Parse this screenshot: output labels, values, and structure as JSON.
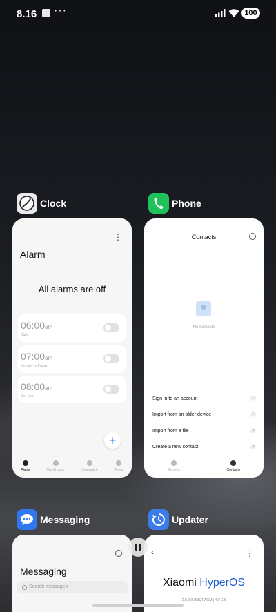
{
  "status_bar": {
    "time": "8.16",
    "more": "···",
    "battery": "100"
  },
  "apps": {
    "clock": {
      "name": "Clock",
      "screen_title": "Alarm",
      "empty_message": "All alarms are off",
      "alarms": [
        {
          "time": "06:00",
          "period": "am",
          "sub": "Daily"
        },
        {
          "time": "07:00",
          "period": "am",
          "sub": "Monday to Friday"
        },
        {
          "time": "08:00",
          "period": "am",
          "sub": "Get Sub"
        }
      ],
      "nav": [
        "Alarm",
        "World clock",
        "Stopwatch",
        "Timer"
      ]
    },
    "phone": {
      "name": "Phone",
      "screen_title": "Contacts",
      "empty_message": "No contacts",
      "options": [
        "Sign in to an account",
        "Import from an older device",
        "Import from a file",
        "Create a new contact"
      ],
      "nav": [
        "Recents",
        "Contacts"
      ]
    },
    "messaging": {
      "name": "Messaging",
      "screen_title": "Messaging",
      "search_placeholder": "Search messages"
    },
    "updater": {
      "name": "Updater",
      "brand_left": "Xiaomi",
      "brand_right": "HyperOS",
      "version": "2.0.5.0.UMQTWXM | 4.0 GB"
    }
  },
  "colors": {
    "clock_icon": "#e9e9ee",
    "phone_icon": "#1fc15a",
    "messaging_icon": "#2f78f0",
    "updater_icon": "#3b7bea",
    "accent_blue": "#3a82f7"
  }
}
